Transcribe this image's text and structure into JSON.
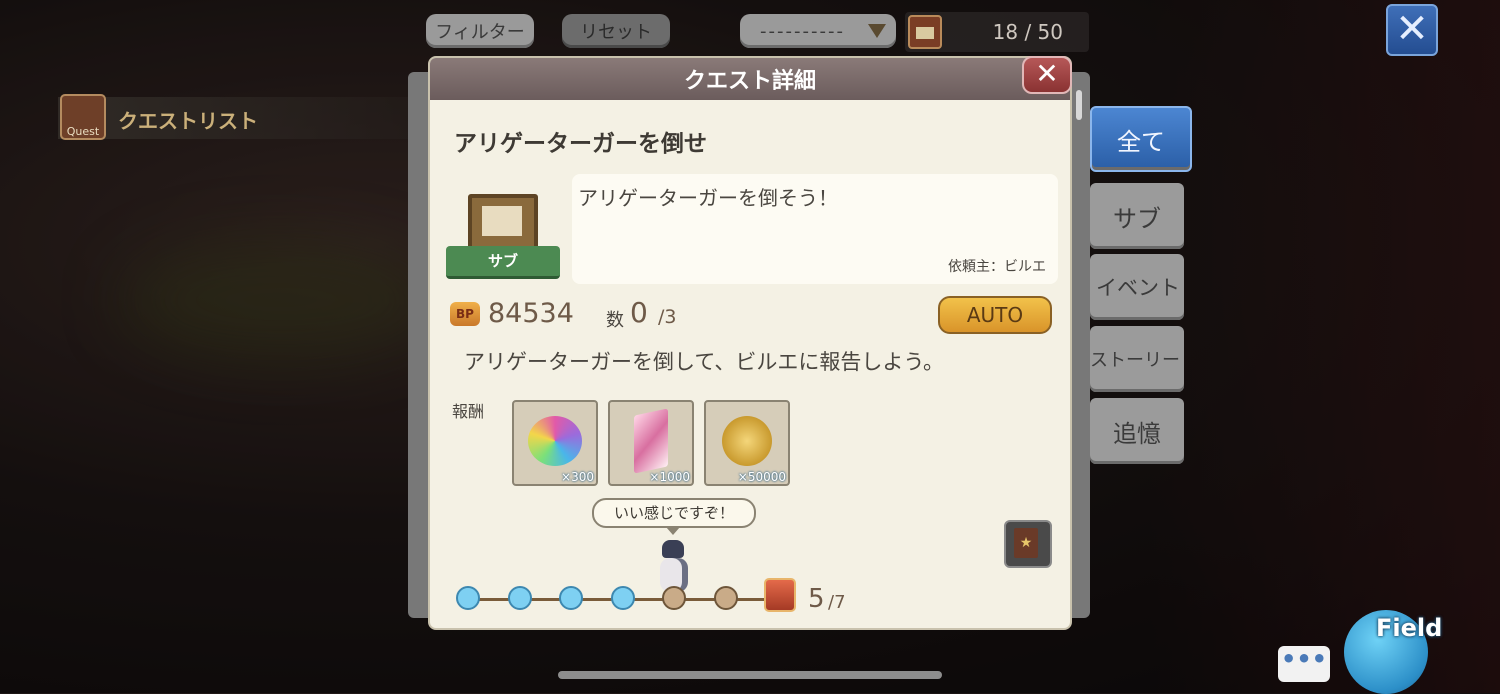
{
  "topbar": {
    "filter_label": "フィルター",
    "reset_label": "リセット",
    "sort_value": "----------",
    "quest_count": "18 / 50"
  },
  "left": {
    "quest_list_label": "クエストリスト",
    "quest_icon_text": "Quest"
  },
  "categories": [
    "全て",
    "サブ",
    "イベント",
    "ストーリー",
    "追憶"
  ],
  "modal": {
    "header": "クエスト詳細",
    "title": "アリゲーターガーを倒せ",
    "badge": "サブ",
    "description": "アリゲーターガーを倒そう！",
    "client": "依頼主：ビルエ",
    "bp_icon": "BP",
    "bp": "84534",
    "count_label": "数",
    "count_current": "0",
    "count_max": "/3",
    "auto_label": "AUTO",
    "instruction": "アリゲーターガーを倒して、ビルエに報告しよう。",
    "reward_label": "報酬",
    "rewards": [
      {
        "icon": "rainbow-gem-icon",
        "qty": "×300"
      },
      {
        "icon": "crystal-icon",
        "qty": "×1000"
      },
      {
        "icon": "gold-coin-icon",
        "qty": "×50000"
      }
    ],
    "speech": "いい感じですぞ！",
    "progress_current": "5",
    "progress_max": "/7",
    "progress_steps_done": 4,
    "progress_steps_total": 6
  },
  "bottom": {
    "chat_label": "•••",
    "field_label": "Field"
  },
  "colors": {
    "accent_blue": "#3f6fb8",
    "auto_gold": "#f2c24a",
    "header_mauve": "#7a6a68"
  }
}
